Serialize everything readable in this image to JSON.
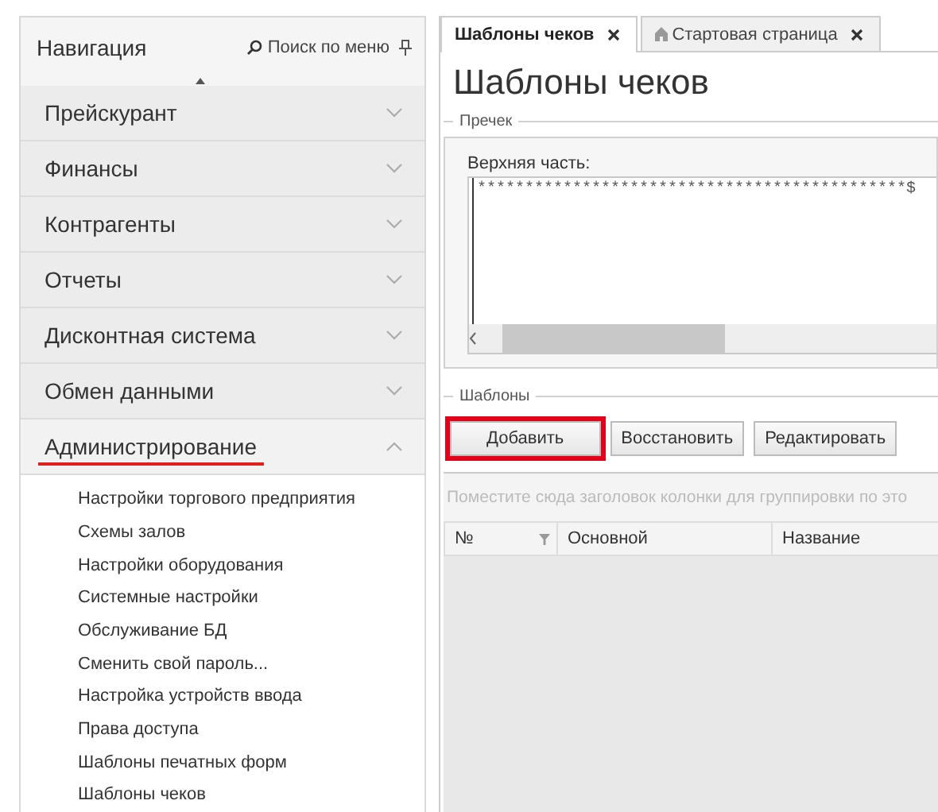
{
  "navigation": {
    "title": "Навигация",
    "search_label": "Поиск по меню",
    "groups": [
      {
        "label": "Прейскурант",
        "expanded": false,
        "highlighted": false
      },
      {
        "label": "Финансы",
        "expanded": false,
        "highlighted": false
      },
      {
        "label": "Контрагенты",
        "expanded": false,
        "highlighted": false
      },
      {
        "label": "Отчеты",
        "expanded": false,
        "highlighted": false
      },
      {
        "label": "Дисконтная система",
        "expanded": false,
        "highlighted": false
      },
      {
        "label": "Обмен данными",
        "expanded": false,
        "highlighted": false
      },
      {
        "label": "Администрирование",
        "expanded": true,
        "highlighted": true,
        "children": [
          {
            "label": "Настройки торгового предприятия"
          },
          {
            "label": "Схемы залов"
          },
          {
            "label": "Настройки оборудования"
          },
          {
            "label": "Системные настройки"
          },
          {
            "label": "Обслуживание БД"
          },
          {
            "label": "Сменить свой пароль..."
          },
          {
            "label": "Настройка устройств ввода"
          },
          {
            "label": "Права доступа"
          },
          {
            "label": "Шаблоны печатных форм"
          },
          {
            "label": "Шаблоны чеков"
          }
        ]
      }
    ]
  },
  "tabs": [
    {
      "label": "Шаблоны чеков",
      "selected": true,
      "kind": "plain"
    },
    {
      "label": "Стартовая страница",
      "selected": false,
      "kind": "home"
    }
  ],
  "page_title": "Шаблоны чеков",
  "precheck": {
    "legend": "Пречек",
    "field_label": "Верхняя часть:",
    "value": "*********************************************$"
  },
  "templates": {
    "legend": "Шаблоны",
    "buttons": [
      {
        "label": "Добавить",
        "highlighted": true
      },
      {
        "label": "Восстановить",
        "highlighted": false
      },
      {
        "label": "Редактировать",
        "highlighted": false
      }
    ],
    "group_hint": "Поместите сюда заголовок колонки для группировки по это",
    "columns": [
      {
        "label": "№",
        "filter": true
      },
      {
        "label": "Основной",
        "filter": false
      },
      {
        "label": "Название",
        "filter": false
      }
    ]
  }
}
